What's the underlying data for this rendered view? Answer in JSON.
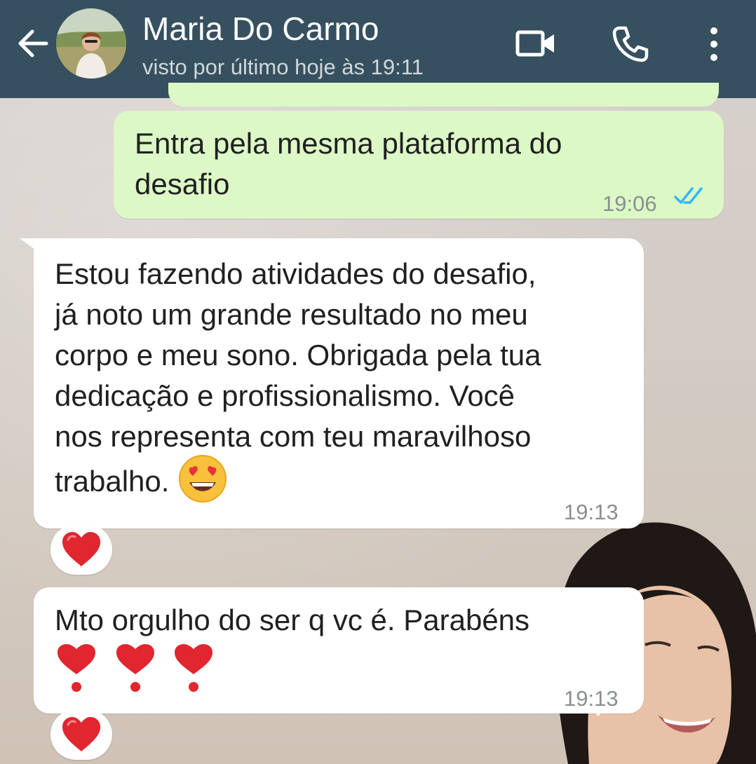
{
  "header": {
    "contact_name": "Maria Do Carmo",
    "last_seen": "visto por último hoje às 19:11",
    "icons": [
      "back-arrow-icon",
      "video-call-icon",
      "voice-call-icon",
      "more-options-icon"
    ],
    "background_color": "#37505f"
  },
  "messages": [
    {
      "direction": "outgoing",
      "lines": [
        "Entra pela mesma plataforma do",
        "desafio"
      ],
      "time": "19:06",
      "status": "read",
      "status_icon": "double-check-icon"
    },
    {
      "direction": "incoming",
      "lines": [
        "Estou fazendo atividades do desafio,",
        "já noto um grande resultado no meu",
        "corpo e meu sono. Obrigada pela tua",
        "dedicação e profissionalismo. Você",
        "nos representa com teu maravilhoso",
        "trabalho."
      ],
      "trailing_emoji": "heart-eyes-emoji-icon",
      "time": "19:13",
      "reaction": "red-heart-icon"
    },
    {
      "direction": "incoming",
      "lines": [
        "Mto orgulho do ser q vc é. Parabéns"
      ],
      "emoji_line": [
        "heart-exclamation-icon",
        "heart-exclamation-icon",
        "heart-exclamation-icon"
      ],
      "time": "19:13",
      "reaction": "red-heart-icon"
    }
  ],
  "colors": {
    "outgoing_bubble": "#dcf8c6",
    "incoming_bubble": "#ffffff",
    "read_check": "#34b7f1",
    "timestamp": "#8a8f90"
  }
}
